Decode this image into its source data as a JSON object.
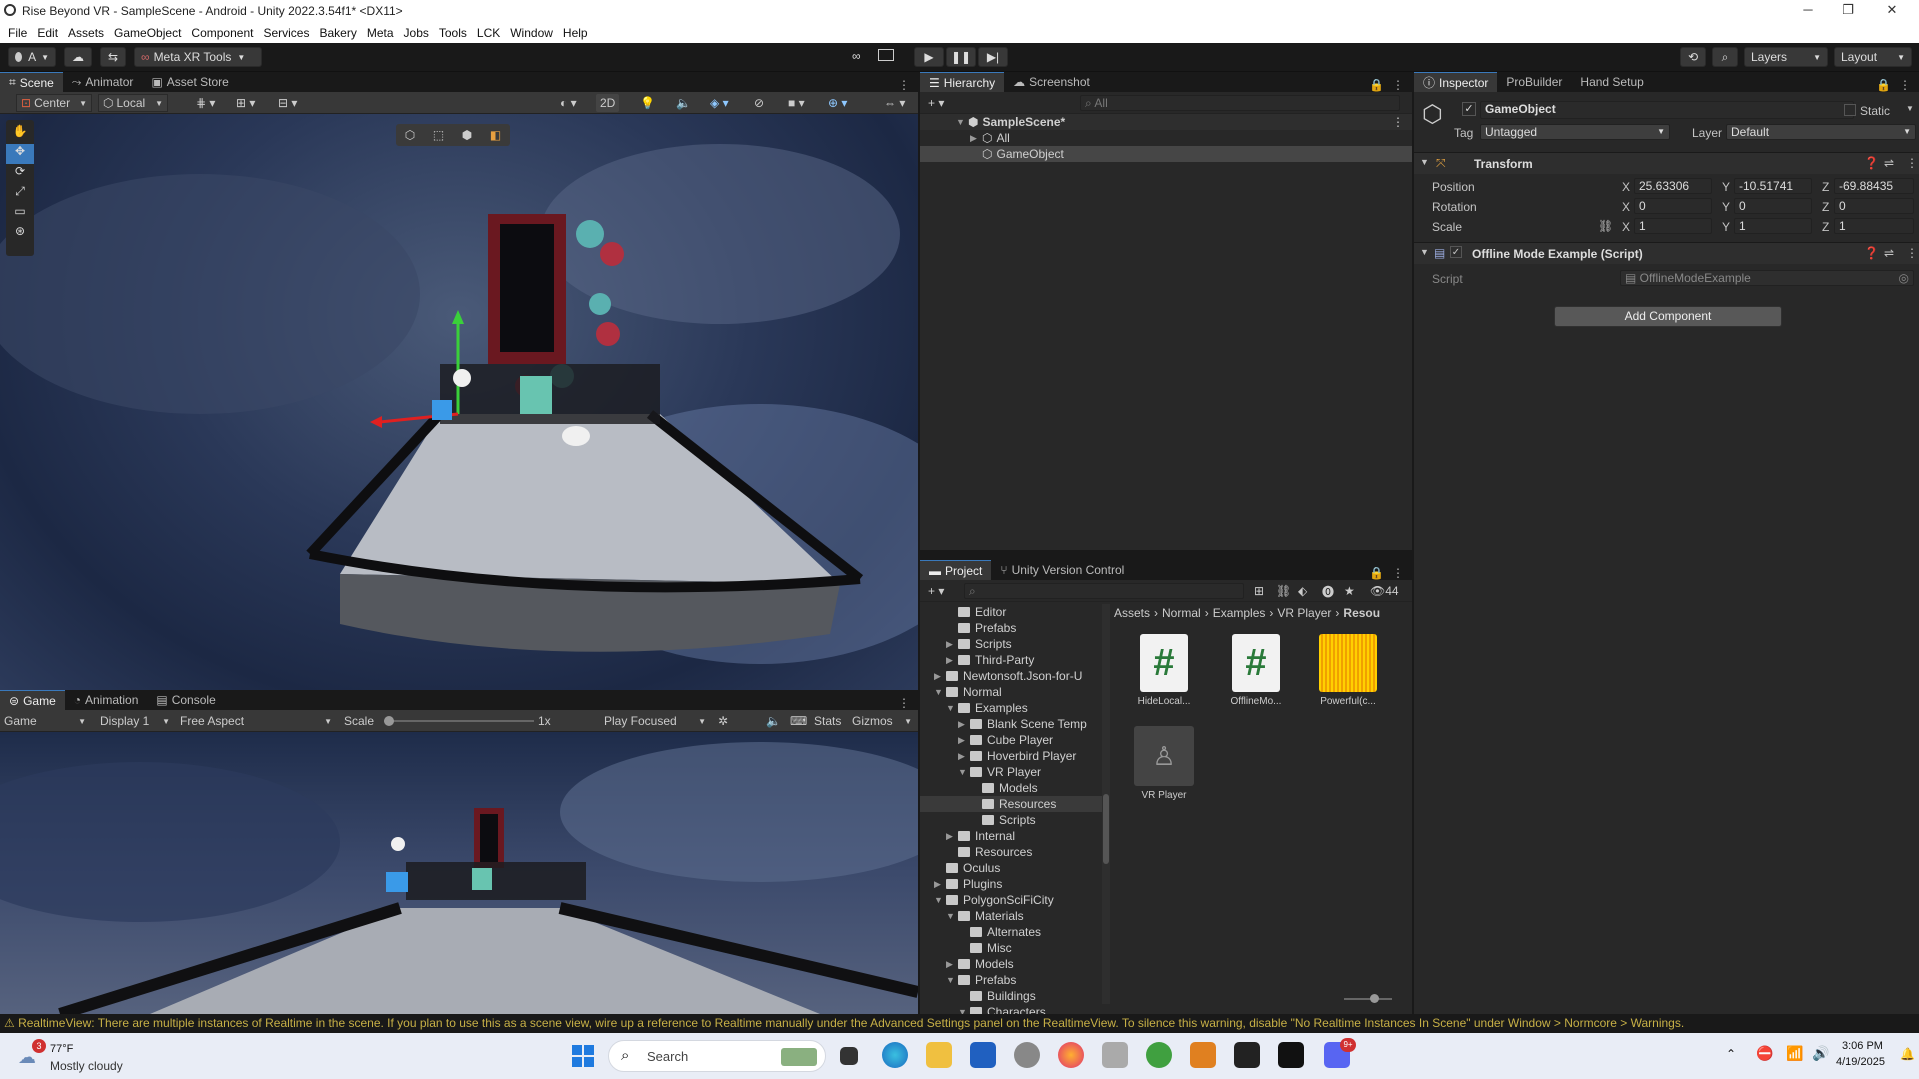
{
  "window": {
    "title": "Rise Beyond VR - SampleScene - Android - Unity 2022.3.54f1* <DX11>"
  },
  "menu": [
    "File",
    "Edit",
    "Assets",
    "GameObject",
    "Component",
    "Services",
    "Bakery",
    "Meta",
    "Jobs",
    "Tools",
    "LCK",
    "Window",
    "Help"
  ],
  "toolbar": {
    "account": "A",
    "meta_tools": "Meta XR Tools",
    "layers": "Layers",
    "layout": "Layout"
  },
  "scene": {
    "tabs": [
      "Scene",
      "Animator",
      "Asset Store"
    ],
    "pivot": "Center",
    "space": "Local",
    "mode2d": "2D"
  },
  "game": {
    "tabs": [
      "Game",
      "Animation",
      "Console"
    ],
    "view": "Game",
    "display": "Display 1",
    "aspect": "Free Aspect",
    "scale_label": "Scale",
    "scale_value": "1x",
    "play_mode": "Play Focused",
    "stats": "Stats",
    "gizmos": "Gizmos"
  },
  "hierarchy": {
    "tabs": [
      "Hierarchy",
      "Screenshot"
    ],
    "search_placeholder": "All",
    "items": [
      "SampleScene*",
      "All",
      "GameObject"
    ]
  },
  "inspector": {
    "tabs": [
      "Inspector",
      "ProBuilder",
      "Hand Setup"
    ],
    "object_name": "GameObject",
    "static_label": "Static",
    "tag_label": "Tag",
    "tag_value": "Untagged",
    "layer_label": "Layer",
    "layer_value": "Default",
    "transform": {
      "title": "Transform",
      "position_label": "Position",
      "rotation_label": "Rotation",
      "scale_label": "Scale",
      "axes": [
        "X",
        "Y",
        "Z"
      ],
      "position": [
        "25.63306",
        "-10.51741",
        "-69.88435"
      ],
      "rotation": [
        "0",
        "0",
        "0"
      ],
      "scale": [
        "1",
        "1",
        "1"
      ]
    },
    "script_component": {
      "title": "Offline Mode Example (Script)",
      "script_label": "Script",
      "script_value": "OfflineModeExample"
    },
    "add_component": "Add Component"
  },
  "project": {
    "tabs": [
      "Project",
      "Unity Version Control"
    ],
    "count": "44",
    "breadcrumb": [
      "Assets",
      "Normal",
      "Examples",
      "VR Player",
      "Resou"
    ],
    "tree": [
      {
        "label": "Editor",
        "indent": 1,
        "arrow": ""
      },
      {
        "label": "Prefabs",
        "indent": 1,
        "arrow": ""
      },
      {
        "label": "Scripts",
        "indent": 1,
        "arrow": "▶"
      },
      {
        "label": "Third-Party",
        "indent": 1,
        "arrow": "▶"
      },
      {
        "label": "Newtonsoft.Json-for-U",
        "indent": 0,
        "arrow": "▶"
      },
      {
        "label": "Normal",
        "indent": 0,
        "arrow": "▼"
      },
      {
        "label": "Examples",
        "indent": 1,
        "arrow": "▼"
      },
      {
        "label": "Blank Scene Temp",
        "indent": 2,
        "arrow": "▶"
      },
      {
        "label": "Cube Player",
        "indent": 2,
        "arrow": "▶"
      },
      {
        "label": "Hoverbird Player",
        "indent": 2,
        "arrow": "▶"
      },
      {
        "label": "VR Player",
        "indent": 2,
        "arrow": "▼"
      },
      {
        "label": "Models",
        "indent": 3,
        "arrow": ""
      },
      {
        "label": "Resources",
        "indent": 3,
        "arrow": ""
      },
      {
        "label": "Scripts",
        "indent": 3,
        "arrow": ""
      },
      {
        "label": "Internal",
        "indent": 1,
        "arrow": "▶"
      },
      {
        "label": "Resources",
        "indent": 1,
        "arrow": ""
      },
      {
        "label": "Oculus",
        "indent": 0,
        "arrow": ""
      },
      {
        "label": "Plugins",
        "indent": 0,
        "arrow": "▶"
      },
      {
        "label": "PolygonSciFiCity",
        "indent": 0,
        "arrow": "▼"
      },
      {
        "label": "Materials",
        "indent": 1,
        "arrow": "▼"
      },
      {
        "label": "Alternates",
        "indent": 2,
        "arrow": ""
      },
      {
        "label": "Misc",
        "indent": 2,
        "arrow": ""
      },
      {
        "label": "Models",
        "indent": 1,
        "arrow": "▶"
      },
      {
        "label": "Prefabs",
        "indent": 1,
        "arrow": "▼"
      },
      {
        "label": "Buildings",
        "indent": 2,
        "arrow": ""
      },
      {
        "label": "Characters",
        "indent": 2,
        "arrow": "▼"
      }
    ],
    "assets": [
      "HideLocal...",
      "OfflineMo...",
      "Powerful(c...",
      "VR Player"
    ]
  },
  "status": {
    "message": "RealtimeView: There are multiple instances of Realtime in the scene. If you plan to use this as a scene view, wire up a reference to Realtime manually under the Advanced Settings panel on the RealtimeView. To silence this warning, disable \"No Realtime Instances In Scene\" under Window > Normcore > Warnings."
  },
  "taskbar": {
    "weather_temp": "77°F",
    "weather_desc": "Mostly cloudy",
    "weather_badge": "3",
    "search": "Search",
    "time": "3:06 PM",
    "date": "4/19/2025",
    "discord_badge": "9+"
  },
  "colors": {
    "accent": "#3a79bb",
    "warning": "#c7b046",
    "panel": "#282828",
    "header": "#383838"
  }
}
